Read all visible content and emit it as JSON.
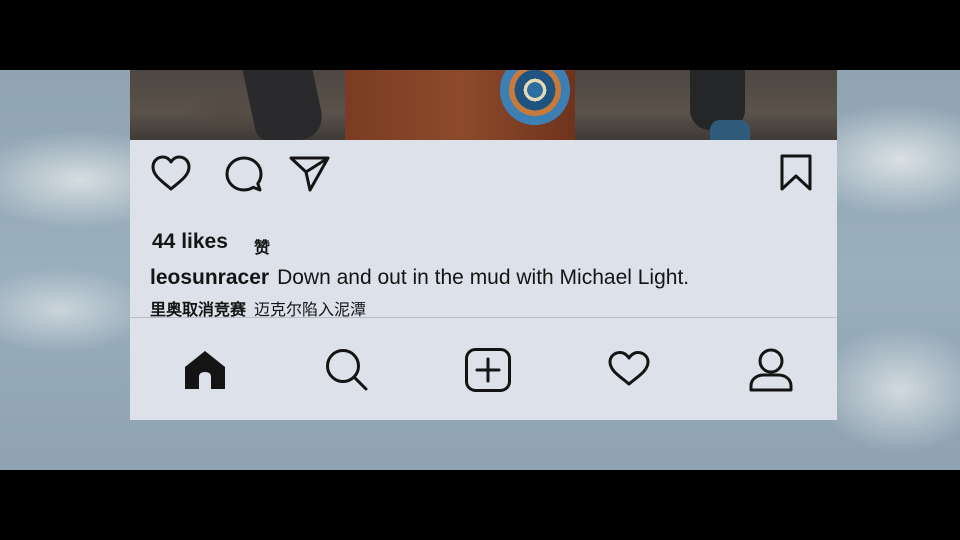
{
  "post": {
    "likes_label": "44 likes",
    "likes_subtitle": "赞",
    "caption_username": "leosunracer",
    "caption_text": "Down and out in the mud with Michael Light.",
    "subtitle_username": "里奥取消竞赛",
    "subtitle_caption": "迈克尔陷入泥潭"
  },
  "actions": {
    "icons": [
      "heart-icon",
      "comment-icon",
      "send-icon",
      "bookmark-icon"
    ]
  },
  "bottom_nav": {
    "icons": [
      "home-icon",
      "search-icon",
      "add-post-icon",
      "activity-heart-icon",
      "profile-icon"
    ]
  },
  "colors": {
    "panel_background": "#dde2ea",
    "text": "#141414",
    "icon": "#141414",
    "letterbox": "#000000"
  }
}
